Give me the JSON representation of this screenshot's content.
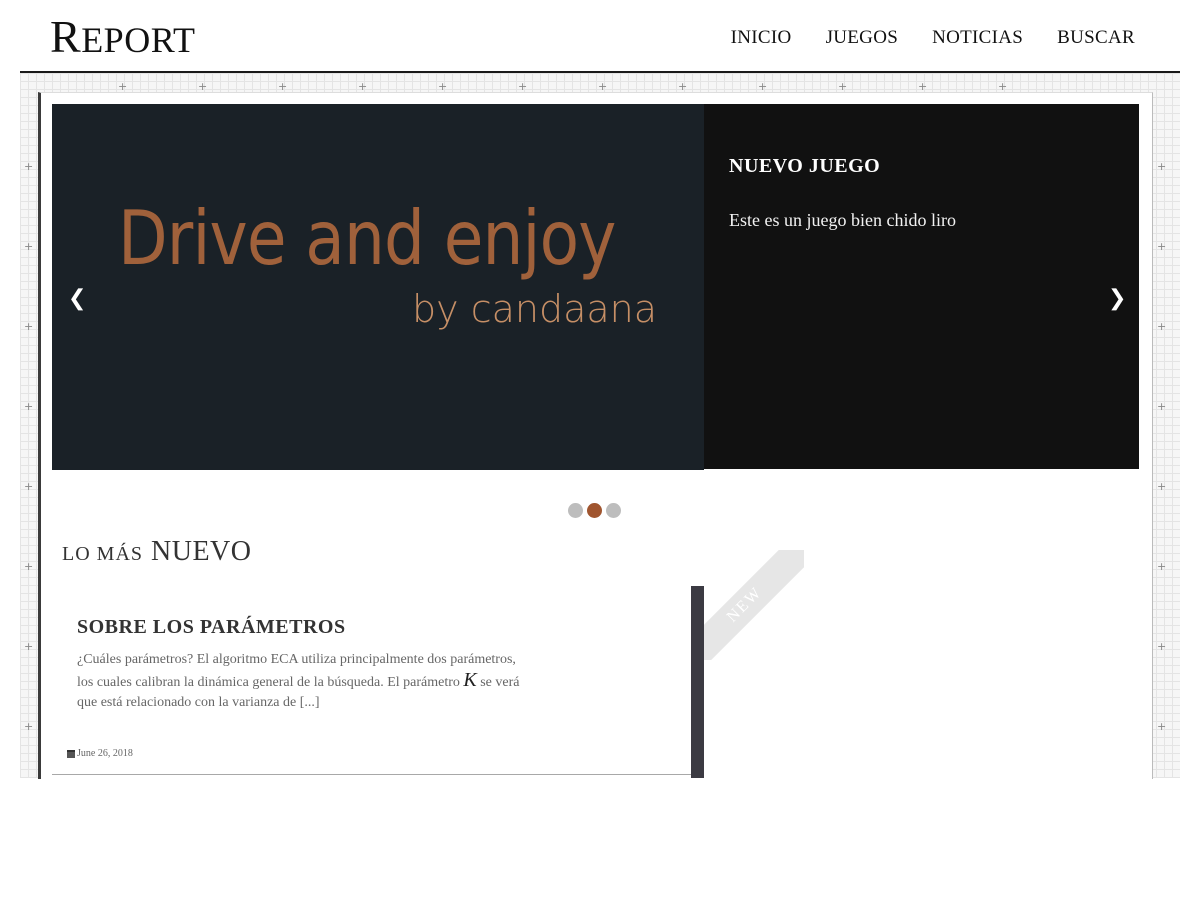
{
  "header": {
    "logo": {
      "cap": "R",
      "rest": "EPORT"
    },
    "nav": [
      "INICIO",
      "JUEGOS",
      "NOTICIAS",
      "BUSCAR"
    ]
  },
  "slider": {
    "image_title": "Drive and enjoy",
    "image_subtitle": "by candaana",
    "title": "NUEVO JUEGO",
    "text": "Este es un juego bien chido liro",
    "prev_arrow": "❮",
    "next_arrow": "❯",
    "dots_count": 3,
    "active_dot": 2
  },
  "section": {
    "small": "LO MÁS",
    "big": "NUEVO"
  },
  "post": {
    "title": "SOBRE LOS PARÁMETROS",
    "excerpt_before": "¿Cuáles parámetros? El algoritmo ECA utiliza principalmente dos parámetros, los cuales calibran la dinámica general de la búsqueda. El parámetro ",
    "math_symbol": "K",
    "excerpt_after": " se verá que está relacionado con la varianza de [...]",
    "date": "June 26, 2018",
    "ribbon": "NEW"
  },
  "colors": {
    "slide_bg": "#1a2127",
    "slide_text_bg": "#111111",
    "accent": "#a0552f",
    "title_orange": "#a0613b"
  }
}
